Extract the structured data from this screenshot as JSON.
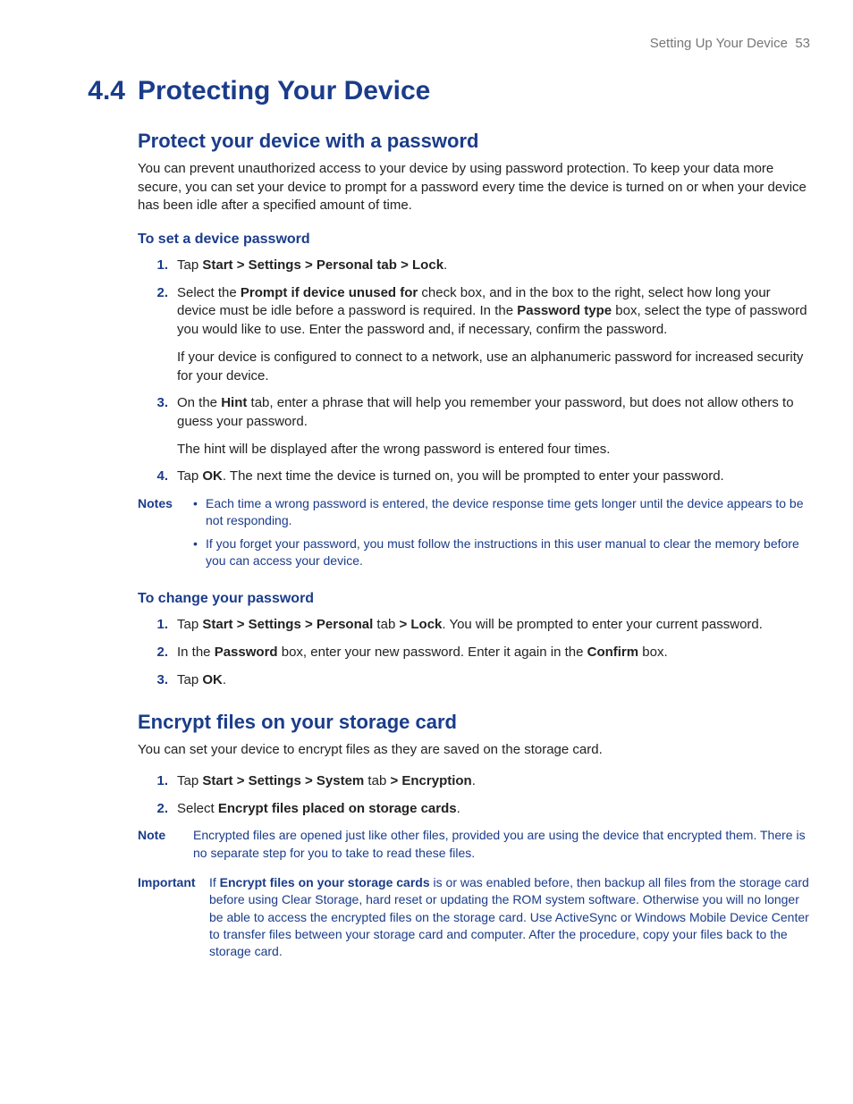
{
  "header": {
    "chapter": "Setting Up Your Device",
    "page": "53"
  },
  "h1": {
    "number": "4.4",
    "title": "Protecting Your Device"
  },
  "sec1": {
    "title": "Protect your device with a password",
    "intro": "You can prevent unauthorized access to your device by using password protection. To keep your data more secure, you can set your device to prompt for a password every time the device is turned on or when your device has been idle after a specified amount of time.",
    "sub1": {
      "title": "To set a device password",
      "steps": {
        "s1": {
          "num": "1.",
          "pre": "Tap ",
          "bold": "Start > Settings > Personal tab > Lock",
          "post": "."
        },
        "s2": {
          "num": "2.",
          "p1a": "Select the ",
          "p1b": "Prompt if device unused for",
          "p1c": " check box, and in the box to the right, select how long your device must be idle before a password is required. In the ",
          "p1d": "Password type",
          "p1e": " box, select the type of password you would like to use. Enter the password and, if necessary, confirm the password.",
          "p2": "If your device is configured to connect to a network, use an alphanumeric password for increased security for your device."
        },
        "s3": {
          "num": "3.",
          "p1a": "On the ",
          "p1b": "Hint",
          "p1c": " tab, enter a phrase that will help you remember your password, but does not allow others to guess your password.",
          "p2": "The hint will be displayed after the wrong password is entered four times."
        },
        "s4": {
          "num": "4.",
          "a": "Tap ",
          "b": "OK",
          "c": ". The next time the device is turned on, you will be prompted to enter your password."
        }
      },
      "notes": {
        "label": "Notes",
        "n1": "Each time a wrong password is entered, the device response time gets longer until the device appears to be not responding.",
        "n2": "If you forget your password, you must follow the instructions in this user manual to clear the memory before you can access your device."
      }
    },
    "sub2": {
      "title": "To change your password",
      "steps": {
        "s1": {
          "num": "1.",
          "a": "Tap ",
          "b": "Start > Settings > Personal",
          "c": " tab ",
          "d": "> Lock",
          "e": ". You will be prompted to enter your current password."
        },
        "s2": {
          "num": "2.",
          "a": "In the ",
          "b": "Password",
          "c": " box, enter your new password. Enter it again in the ",
          "d": "Confirm",
          "e": " box."
        },
        "s3": {
          "num": "3.",
          "a": "Tap ",
          "b": "OK",
          "c": "."
        }
      }
    }
  },
  "sec2": {
    "title": "Encrypt files on your storage card",
    "intro": "You can set your device to encrypt files as they are saved on the storage card.",
    "steps": {
      "s1": {
        "num": "1.",
        "a": "Tap ",
        "b": "Start > Settings > System",
        "c": " tab ",
        "d": "> Encryption",
        "e": "."
      },
      "s2": {
        "num": "2.",
        "a": "Select ",
        "b": "Encrypt files placed on storage cards",
        "c": "."
      }
    },
    "note": {
      "label": "Note",
      "text": "Encrypted files are opened just like other files, provided you are using the device that encrypted them. There is no separate step for you to take to read these files."
    },
    "important": {
      "label": "Important",
      "a": "If ",
      "b": "Encrypt files on your storage cards",
      "c": " is or was enabled before, then backup all files from the storage card before using Clear Storage, hard reset or updating the ROM system software. Otherwise you will no longer be able to access the encrypted files on the storage card. Use ActiveSync or Windows Mobile Device Center to transfer files between your storage card and computer. After the procedure, copy your files back to the storage card."
    }
  }
}
